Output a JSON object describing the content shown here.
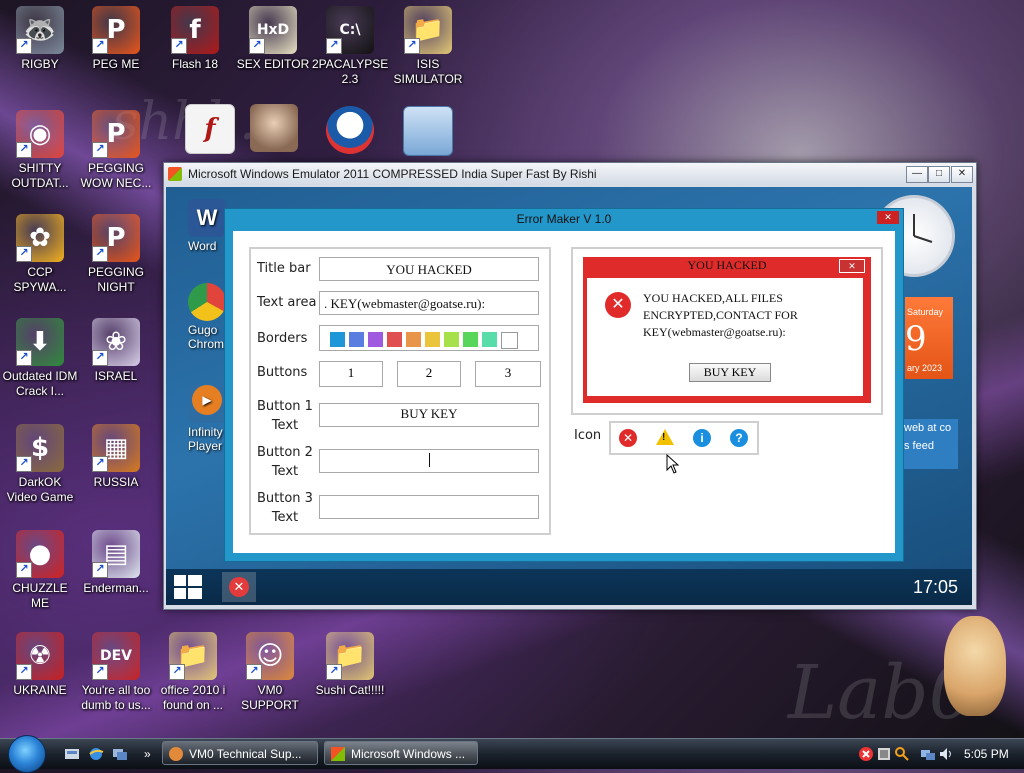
{
  "desktop": {
    "watermark_small": "shhh...",
    "watermark_big": "Lab0",
    "icons": [
      {
        "label": "RIGBY",
        "glyph": "🦝",
        "color": "#7b8a99"
      },
      {
        "label": "PEG ME",
        "glyph": "P",
        "color": "#e8551a"
      },
      {
        "label": "Flash 18",
        "glyph": "f",
        "color": "#b01818"
      },
      {
        "label": "SEX EDITOR",
        "glyph": "HxD",
        "color": "#e9e2c2"
      },
      {
        "label": "2PACALYPSE 2.3",
        "glyph": "C:\\",
        "color": "#111111"
      },
      {
        "label": "ISIS SIMULATOR",
        "glyph": "📁",
        "color": "#e3c774"
      },
      {
        "label": "SHITTY OUTDAT...",
        "glyph": "◉",
        "color": "#e0443a"
      },
      {
        "label": "PEGGING WOW NEC...",
        "glyph": "P",
        "color": "#e8551a"
      },
      {
        "label": "CCP SPYWA...",
        "glyph": "✿",
        "color": "#f2b21b"
      },
      {
        "label": "PEGGING NIGHT",
        "glyph": "P",
        "color": "#e8551a"
      },
      {
        "label": "Outdated IDM Crack I...",
        "glyph": "⬇",
        "color": "#2e8b3a"
      },
      {
        "label": "ISRAEL",
        "glyph": "❀",
        "color": "#d8d0e8"
      },
      {
        "label": "DarkOK Video Game",
        "glyph": "$",
        "color": "#8a6a3a"
      },
      {
        "label": "RUSSIA",
        "glyph": "▦",
        "color": "#d67a1c"
      },
      {
        "label": "CHUZZLE ME",
        "glyph": "●",
        "color": "#d02222"
      },
      {
        "label": "Enderman...",
        "glyph": "▤",
        "color": "#dfe6ef"
      },
      {
        "label": "UKRAINE",
        "glyph": "☢",
        "color": "#c81f1f"
      },
      {
        "label": "You're all too dumb to us...",
        "glyph": "DEV",
        "color": "#c62323"
      },
      {
        "label": "office 2010 i found on ...",
        "glyph": "📁",
        "color": "#e3c774"
      },
      {
        "label": "VM0 SUPPORT",
        "glyph": "☺",
        "color": "#e08a3a"
      },
      {
        "label": "Sushi Cat!!!!!",
        "glyph": "📁",
        "color": "#e3c774"
      }
    ],
    "unlabeled_icons": [
      "flash-file-icon",
      "portrait-icon",
      "obama-logo-icon",
      "window-app-icon"
    ]
  },
  "emulator": {
    "title": "Microsoft Windows Emulator 2011 COMPRESSED India Super Fast By Rishi",
    "minimize": "—",
    "maximize": "□",
    "close": "✕",
    "icons": [
      {
        "label": "Word",
        "glyph": "W",
        "color": "#2b5797"
      },
      {
        "label": "Gugo Chromium",
        "glyph": "◉",
        "color": "#e0443a"
      },
      {
        "label": "Infinity Player",
        "glyph": "▶",
        "color": "#e67e22"
      }
    ],
    "calendar": {
      "day": "Saturday",
      "num": "9",
      "month": "ary 2023"
    },
    "feed": {
      "line1": "web at co",
      "line2": "s feed"
    },
    "clock": "17:05"
  },
  "error_maker": {
    "title": "Error Maker V 1.0",
    "close": "✕",
    "labels": {
      "title_bar": "Title bar",
      "text_area": "Text area",
      "borders": "Borders",
      "buttons": "Buttons",
      "button1_a": "Button 1",
      "button1_b": "Text",
      "button2_a": "Button 2",
      "button2_b": "Text",
      "button3_a": "Button 3",
      "button3_b": "Text",
      "icon": "Icon"
    },
    "fields": {
      "title_bar": "YOU HACKED",
      "text_area": ". KEY(webmaster@goatse.ru):",
      "button1": "BUY KEY",
      "button2": "",
      "button3": ""
    },
    "border_colors": [
      "#1e96d8",
      "#5a7ee0",
      "#a05ae0",
      "#e05050",
      "#e8954a",
      "#eac43a",
      "#a6e04a",
      "#58d65a",
      "#58dcaa",
      "#ffffff"
    ],
    "button_counts": [
      "1",
      "2",
      "3"
    ],
    "icon_choices": [
      {
        "name": "error-choice-icon",
        "glyph": "✕",
        "color": "#e12b2b"
      },
      {
        "name": "warning-choice-icon",
        "glyph": "!",
        "color": "#f2c200"
      },
      {
        "name": "info-choice-icon",
        "glyph": "i",
        "color": "#1a8fe0"
      },
      {
        "name": "question-choice-icon",
        "glyph": "?",
        "color": "#1a8fe0"
      }
    ],
    "preview": {
      "title": "YOU HACKED",
      "close": "✕",
      "message": "YOU HACKED,ALL FILES ENCRYPTED,CONTACT FOR KEY(webmaster@goatse.ru):",
      "button": "BUY KEY"
    }
  },
  "taskbar": {
    "buttons": [
      "VM0 Technical Sup...",
      "Microsoft Windows ..."
    ],
    "chevron": "»",
    "time": "5:05 PM"
  }
}
